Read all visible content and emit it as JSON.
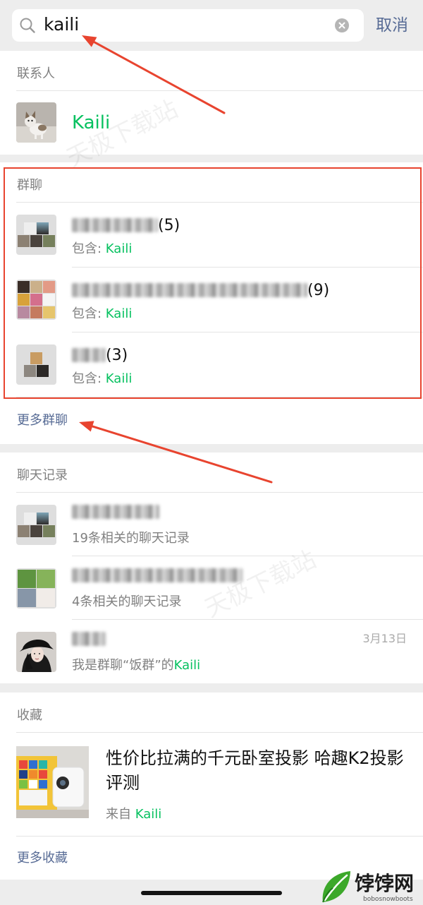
{
  "search": {
    "query": "kaili",
    "icon": "search-icon",
    "clear_icon": "clear-icon",
    "cancel_label": "取消"
  },
  "contacts": {
    "header": "联系人",
    "items": [
      {
        "name": "Kaili"
      }
    ]
  },
  "groups": {
    "header": "群聊",
    "items": [
      {
        "member_count_label": "(5)",
        "contains_label": "包含: ",
        "contains_keyword": "Kaili"
      },
      {
        "member_count_label": "(9)",
        "contains_label": "包含: ",
        "contains_keyword": "Kaili"
      },
      {
        "member_count_label": "(3)",
        "contains_label": "包含: ",
        "contains_keyword": "Kaili"
      }
    ],
    "more_label": "更多群聊"
  },
  "chat_records": {
    "header": "聊天记录",
    "items": [
      {
        "subtitle": "19条相关的聊天记录"
      },
      {
        "subtitle": "4条相关的聊天记录"
      },
      {
        "date": "3月13日",
        "subtitle": "我是群聊“饭群”的",
        "subtitle_keyword": "Kaili"
      }
    ]
  },
  "favorites": {
    "header": "收藏",
    "items": [
      {
        "title": "性价比拉满的千元卧室投影 哈趣K2投影评测",
        "source_label": "来自 ",
        "source_keyword": "Kaili"
      }
    ],
    "more_label": "更多收藏"
  },
  "watermark": {
    "text": "天极下载站"
  },
  "logo": {
    "text": "饽饽网",
    "subtext": "bobosnowboots"
  },
  "colors": {
    "highlight_green": "#07c160",
    "link_blue": "#576b95",
    "annotation_red": "#e8442f",
    "background_gray": "#ededed"
  }
}
